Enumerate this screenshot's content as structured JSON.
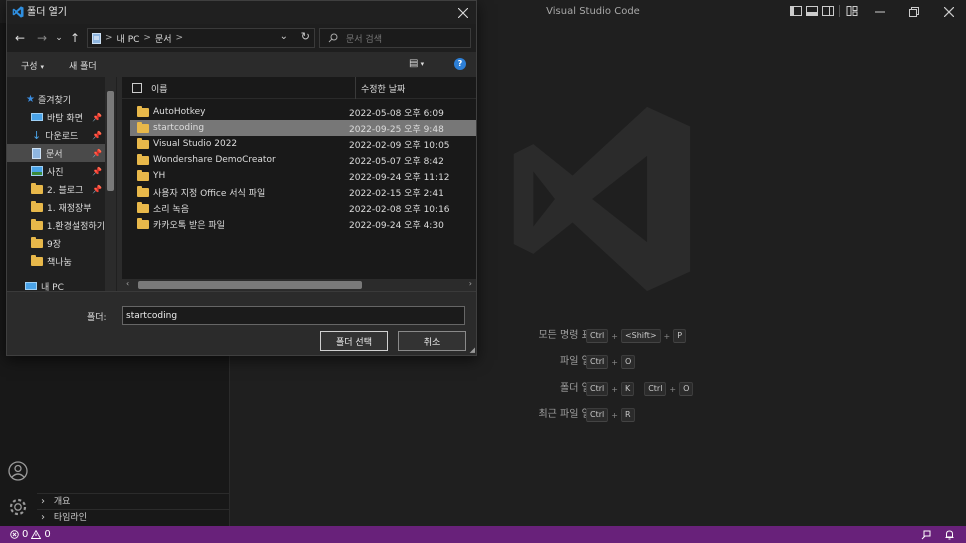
{
  "vscode": {
    "window_title": "Visual Studio Code",
    "shortcuts": [
      {
        "label": "모든 명령 표시",
        "keys": [
          "Ctrl",
          "+",
          "<Shift>",
          "+",
          "P"
        ]
      },
      {
        "label": "파일 열기",
        "keys": [
          "Ctrl",
          "+",
          "O"
        ]
      },
      {
        "label": "폴더 열기",
        "keys": [
          "Ctrl",
          "+",
          "K",
          "Ctrl",
          "+",
          "O"
        ]
      },
      {
        "label": "최근 파일 열기",
        "keys": [
          "Ctrl",
          "+",
          "R"
        ]
      }
    ],
    "sidebar_sections": [
      {
        "label": "개요"
      },
      {
        "label": "타임라인"
      }
    ],
    "status": {
      "errors": "0",
      "warnings": "0"
    },
    "colors": {
      "statusbar": "#68217a",
      "logo": "#2b2b2b"
    }
  },
  "dialog": {
    "title": "폴더 열기",
    "breadcrumb": [
      "내 PC",
      "문서"
    ],
    "search_placeholder": "문서 검색",
    "toolbar": {
      "organize": "구성",
      "new_folder": "새 폴더"
    },
    "nav_items": [
      {
        "label": "즐겨찾기",
        "icon": "star-icon",
        "pinned": false
      },
      {
        "label": "바탕 화면",
        "icon": "desktop-icon",
        "pinned": true
      },
      {
        "label": "다운로드",
        "icon": "download-icon",
        "pinned": true
      },
      {
        "label": "문서",
        "icon": "document-icon",
        "pinned": true,
        "selected": true
      },
      {
        "label": "사진",
        "icon": "picture-icon",
        "pinned": true
      },
      {
        "label": "2. 블로그",
        "icon": "folder-icon",
        "pinned": true
      },
      {
        "label": "1. 재정장부",
        "icon": "folder-icon",
        "pinned": false
      },
      {
        "label": "1.환경설정하기",
        "icon": "folder-icon",
        "pinned": false
      },
      {
        "label": "9장",
        "icon": "folder-icon",
        "pinned": false
      },
      {
        "label": "책나눔",
        "icon": "folder-icon",
        "pinned": false
      },
      {
        "label": "내 PC",
        "icon": "pc-icon",
        "pinned": false
      }
    ],
    "columns": {
      "name": "이름",
      "modified": "수정한 날짜"
    },
    "files": [
      {
        "name": "AutoHotkey",
        "modified": "2022-05-08 오후 6:09"
      },
      {
        "name": "startcoding",
        "modified": "2022-09-25 오후 9:48",
        "selected": true
      },
      {
        "name": "Visual Studio 2022",
        "modified": "2022-02-09 오후 10:05"
      },
      {
        "name": "Wondershare DemoCreator",
        "modified": "2022-05-07 오후 8:42"
      },
      {
        "name": "YH",
        "modified": "2022-09-24 오후 11:12"
      },
      {
        "name": "사용자 지정 Office 서식 파일",
        "modified": "2022-02-15 오후 2:41"
      },
      {
        "name": "소리 녹음",
        "modified": "2022-02-08 오후 10:16"
      },
      {
        "name": "카카오톡 받은 파일",
        "modified": "2022-09-24 오후 4:30"
      }
    ],
    "folder_label": "폴더:",
    "folder_value": "startcoding",
    "select_button": "폴더 선택",
    "cancel_button": "취소"
  }
}
